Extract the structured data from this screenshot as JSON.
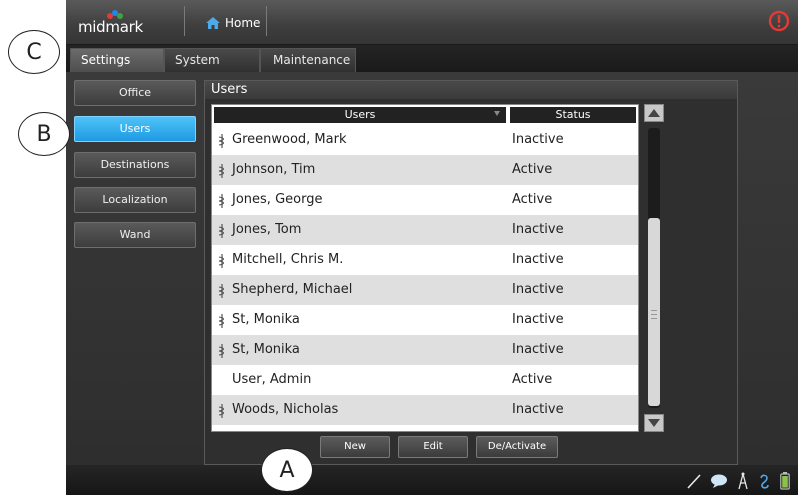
{
  "app": {
    "logo_text": "midmark",
    "home_label": "Home",
    "brand_colors": {
      "dot1": "#e53935",
      "dot2": "#1e88e5",
      "dot3": "#43a047",
      "power": "#e53935",
      "accent": "#1e9ae3"
    }
  },
  "tabs": [
    {
      "label": "Settings",
      "active": true
    },
    {
      "label": "System",
      "active": false
    },
    {
      "label": "Maintenance",
      "active": false
    }
  ],
  "sidebar": {
    "items": [
      {
        "label": "Office",
        "active": false
      },
      {
        "label": "Users",
        "active": true
      },
      {
        "label": "Destinations",
        "active": false
      },
      {
        "label": "Localization",
        "active": false
      },
      {
        "label": "Wand",
        "active": false
      }
    ]
  },
  "panel": {
    "title": "Users",
    "columns": {
      "users": "Users",
      "status": "Status"
    },
    "rows": [
      {
        "name": "Greenwood, Mark",
        "status": "Inactive",
        "icon": "caduceus-icon"
      },
      {
        "name": "Johnson, Tim",
        "status": "Active",
        "icon": "caduceus-icon"
      },
      {
        "name": "Jones, George",
        "status": "Active",
        "icon": "caduceus-icon"
      },
      {
        "name": "Jones, Tom",
        "status": "Inactive",
        "icon": "caduceus-icon"
      },
      {
        "name": "Mitchell, Chris M.",
        "status": "Inactive",
        "icon": "caduceus-icon"
      },
      {
        "name": "Shepherd, Michael",
        "status": "Inactive",
        "icon": "caduceus-icon"
      },
      {
        "name": "St, Monika",
        "status": "Inactive",
        "icon": "caduceus-icon"
      },
      {
        "name": "St, Monika",
        "status": "Inactive",
        "icon": "caduceus-icon"
      },
      {
        "name": "User, Admin",
        "status": "Active",
        "icon": ""
      },
      {
        "name": "Woods, Nicholas",
        "status": "Inactive",
        "icon": "caduceus-icon"
      }
    ],
    "actions": {
      "new": "New",
      "edit": "Edit",
      "deactivate": "De/Activate"
    }
  },
  "callouts": {
    "a": "A",
    "b": "B",
    "c": "C"
  },
  "statusbar_icons": [
    "pen-icon",
    "chat-icon",
    "antenna-icon",
    "ear-icon",
    "battery-icon"
  ]
}
